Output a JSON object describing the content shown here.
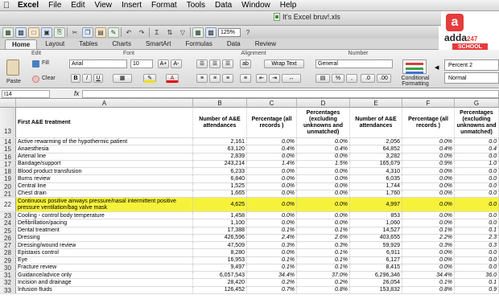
{
  "menubar": {
    "items": [
      "Excel",
      "File",
      "Edit",
      "View",
      "Insert",
      "Format",
      "Tools",
      "Data",
      "Window",
      "Help"
    ]
  },
  "window": {
    "title": "It's Excel bruv!.xls"
  },
  "toolbar": {
    "zoom": "125%"
  },
  "ribbon": {
    "tabs": [
      "Home",
      "Layout",
      "Tables",
      "Charts",
      "SmartArt",
      "Formulas",
      "Data",
      "Review"
    ],
    "groups": {
      "edit": "Edit",
      "font": "Font",
      "alignment": "Alignment",
      "number": "Number"
    },
    "fill_label": "Fill",
    "clear_label": "Clear",
    "paste_label": "Paste",
    "font_name": "Arial",
    "font_size": "10",
    "wrap_text": "Wrap Text",
    "number_format": "General",
    "conditional_formatting": "Conditional Formatting",
    "styles": [
      "Percent 2",
      "Normal"
    ]
  },
  "logo": {
    "brand": "adda",
    "sup": "247",
    "school": "SCHOOL"
  },
  "formula_bar": {
    "name_box": "I14",
    "fx": "fx"
  },
  "columns": [
    "A",
    "B",
    "C",
    "D",
    "E",
    "F",
    "G"
  ],
  "header": {
    "row": "13",
    "a": "First A&E treatment",
    "b": "Number of A&E attendances",
    "c": "Percentage (all records )",
    "d": "Percentages (excluding unknowns and unmatched)",
    "e": "Number of A&E attendances",
    "f": "Percentage (all records )",
    "g": "Percentages (excluding unknowns and unmatched)"
  },
  "rows": [
    {
      "n": "14",
      "a": "Active rewarming of the hypothermic patient",
      "b": "2,161",
      "c": "0.0%",
      "d": "0.0%",
      "e": "2,056",
      "f": "0.0%",
      "g": "0.0"
    },
    {
      "n": "15",
      "a": "Anaesthesia",
      "b": "63,120",
      "c": "0.4%",
      "d": "0.4%",
      "e": "64,852",
      "f": "0.4%",
      "g": "0.4"
    },
    {
      "n": "16",
      "a": "Arterial line",
      "b": "2,839",
      "c": "0.0%",
      "d": "0.0%",
      "e": "3,282",
      "f": "0.0%",
      "g": "0.0"
    },
    {
      "n": "17",
      "a": "Bandage/support",
      "b": "243,214",
      "c": "1.4%",
      "d": "1.5%",
      "e": "165,679",
      "f": "0.9%",
      "g": "1.0"
    },
    {
      "n": "18",
      "a": "Blood product transfusion",
      "b": "6,233",
      "c": "0.0%",
      "d": "0.0%",
      "e": "4,310",
      "f": "0.0%",
      "g": "0.0"
    },
    {
      "n": "19",
      "a": "Burns review",
      "b": "6,840",
      "c": "0.0%",
      "d": "0.0%",
      "e": "6,035",
      "f": "0.0%",
      "g": "0.0"
    },
    {
      "n": "20",
      "a": "Central line",
      "b": "1,525",
      "c": "0.0%",
      "d": "0.0%",
      "e": "1,744",
      "f": "0.0%",
      "g": "0.0"
    },
    {
      "n": "21",
      "a": "Chest drain",
      "b": "1,665",
      "c": "0.0%",
      "d": "0.0%",
      "e": "1,760",
      "f": "0.0%",
      "g": "0.0"
    },
    {
      "n": "22",
      "a": "Continuous positive airways pressure/nasal intermittent positive pressure ventilation/bag valve mask",
      "b": "4,625",
      "c": "0.0%",
      "d": "0.0%",
      "e": "4,997",
      "f": "0.0%",
      "g": "0.0",
      "hl": true
    },
    {
      "n": "23",
      "a": "Cooling - control body temperature",
      "b": "1,458",
      "c": "0.0%",
      "d": "0.0%",
      "e": "853",
      "f": "0.0%",
      "g": "0.0"
    },
    {
      "n": "24",
      "a": "Defibrillation/pacing",
      "b": "1,100",
      "c": "0.0%",
      "d": "0.0%",
      "e": "1,060",
      "f": "0.0%",
      "g": "0.0"
    },
    {
      "n": "25",
      "a": "Dental treatment",
      "b": "17,388",
      "c": "0.1%",
      "d": "0.1%",
      "e": "14,527",
      "f": "0.1%",
      "g": "0.1"
    },
    {
      "n": "26",
      "a": "Dressing",
      "b": "426,596",
      "c": "2.4%",
      "d": "2.6%",
      "e": "403,655",
      "f": "2.2%",
      "g": "2.3"
    },
    {
      "n": "27",
      "a": "Dressing/wound review",
      "b": "47,509",
      "c": "0.3%",
      "d": "0.3%",
      "e": "59,929",
      "f": "0.3%",
      "g": "0.3"
    },
    {
      "n": "28",
      "a": "Epistaxis control",
      "b": "8,280",
      "c": "0.0%",
      "d": "0.1%",
      "e": "6,911",
      "f": "0.0%",
      "g": "0.0"
    },
    {
      "n": "29",
      "a": "Eye",
      "b": "16,953",
      "c": "0.1%",
      "d": "0.1%",
      "e": "6,127",
      "f": "0.0%",
      "g": "0.0"
    },
    {
      "n": "30",
      "a": "Fracture review",
      "b": "9,497",
      "c": "0.1%",
      "d": "0.1%",
      "e": "8,415",
      "f": "0.0%",
      "g": "0.0"
    },
    {
      "n": "31",
      "a": "Guidance/advice only",
      "b": "6,057,543",
      "c": "34.4%",
      "d": "37.0%",
      "e": "6,296,346",
      "f": "34.4%",
      "g": "36.0"
    },
    {
      "n": "32",
      "a": "Incision and drainage",
      "b": "28,420",
      "c": "0.2%",
      "d": "0.2%",
      "e": "26,054",
      "f": "0.1%",
      "g": "0.1"
    },
    {
      "n": "33",
      "a": "Infusion fluids",
      "b": "126,452",
      "c": "0.7%",
      "d": "0.8%",
      "e": "153,832",
      "f": "0.8%",
      "g": "0.9"
    }
  ]
}
